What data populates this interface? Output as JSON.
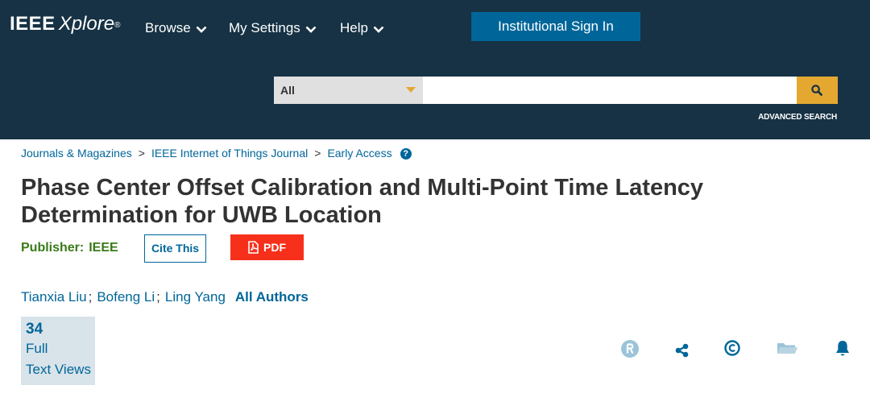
{
  "header": {
    "logo_primary": "IEEE",
    "logo_secondary": "Xplore",
    "logo_mark": "®",
    "nav": {
      "browse": "Browse",
      "settings": "My Settings",
      "help": "Help"
    },
    "institutional_sign_in": "Institutional Sign In",
    "search": {
      "scope": "All",
      "query": "",
      "button_icon": "search-icon"
    },
    "advanced_search": "ADVANCED SEARCH"
  },
  "breadcrumb": {
    "items": [
      "Journals & Magazines",
      "IEEE Internet of Things Journal",
      "Early Access"
    ],
    "separator": ">",
    "help_glyph": "?"
  },
  "article": {
    "title": "Phase Center Offset Calibration and Multi-Point Time Latency Determination for UWB Location",
    "publisher_label": "Publisher:",
    "publisher_value": "IEEE",
    "cite_label": "Cite This",
    "pdf_label": "PDF",
    "authors": [
      "Tianxia Liu",
      "Bofeng Li",
      "Ling Yang"
    ],
    "author_separator": ";",
    "all_authors_label": "All Authors",
    "views_count": "34",
    "views_label_line1": "Full",
    "views_label_line2": "Text Views"
  },
  "tools": [
    "rights-permissions-icon",
    "share-icon",
    "copyright-icon",
    "folder-icon",
    "bell-icon"
  ],
  "colors": {
    "header_bg": "#163244",
    "link": "#006699",
    "accent_gold": "#e4a831",
    "pdf_red": "#f7301b",
    "publisher_green": "#3a7a1a",
    "tool_icon": "#006699"
  }
}
